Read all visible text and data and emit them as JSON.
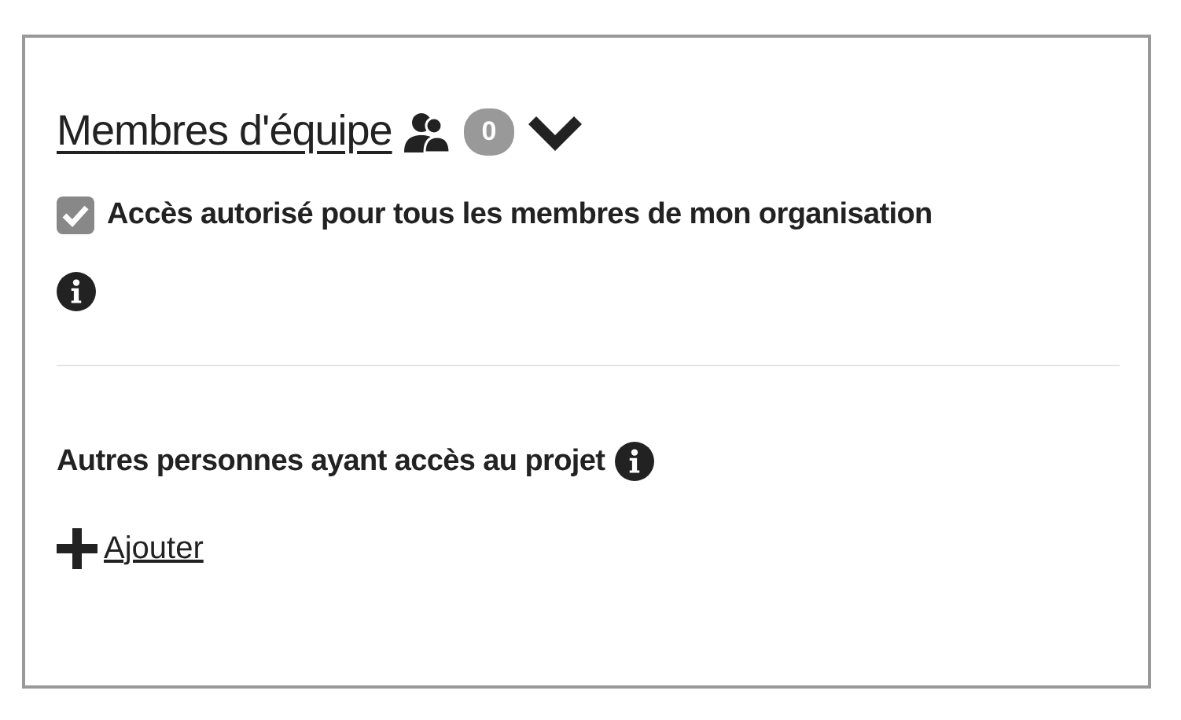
{
  "team": {
    "title": "Membres d'équipe",
    "count": "0"
  },
  "org_access": {
    "label": "Accès autorisé pour tous les membres de mon organisation",
    "checked": true
  },
  "others": {
    "label": "Autres personnes ayant accès au projet"
  },
  "add_link": "Ajouter"
}
